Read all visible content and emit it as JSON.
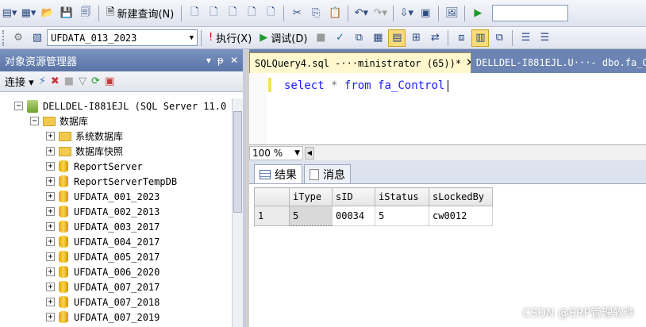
{
  "toolbar1": {
    "new_query_label": "新建查询(N)"
  },
  "toolbar2": {
    "database_combo": "UFDATA_013_2023",
    "execute_label": "执行(X)",
    "debug_label": "调试(D)"
  },
  "object_explorer": {
    "title": "对象资源管理器",
    "pin_glyph": "ꟷ ₱ ✕",
    "connect_label": "连接",
    "server": "DELLDEL-I881EJL (SQL Server 11.0",
    "databases_folder": "数据库",
    "items": [
      {
        "label": "系统数据库",
        "type": "folder"
      },
      {
        "label": "数据库快照",
        "type": "folder"
      },
      {
        "label": "ReportServer",
        "type": "db"
      },
      {
        "label": "ReportServerTempDB",
        "type": "db"
      },
      {
        "label": "UFDATA_001_2023",
        "type": "db"
      },
      {
        "label": "UFDATA_002_2013",
        "type": "db"
      },
      {
        "label": "UFDATA_003_2017",
        "type": "db"
      },
      {
        "label": "UFDATA_004_2017",
        "type": "db"
      },
      {
        "label": "UFDATA_005_2017",
        "type": "db"
      },
      {
        "label": "UFDATA_006_2020",
        "type": "db"
      },
      {
        "label": "UFDATA_007_2017",
        "type": "db"
      },
      {
        "label": "UFDATA_007_2018",
        "type": "db"
      },
      {
        "label": "UFDATA_007_2019",
        "type": "db"
      }
    ]
  },
  "tabs": {
    "active": "SQLQuery4.sql -···ministrator (65))*",
    "active_close": "✕",
    "inactive": "DELLDEL-I881EJL.U···- dbo.fa_C"
  },
  "editor": {
    "kw1": "select",
    "star": "*",
    "kw2": "from",
    "table": "fa_Control"
  },
  "zoom": "100 %",
  "result_tabs": {
    "results": "结果",
    "messages": "消息"
  },
  "results": {
    "columns": [
      "iType",
      "sID",
      "iStatus",
      "sLockedBy"
    ],
    "rows": [
      {
        "num": "1",
        "cells": [
          "5",
          "00034",
          "5",
          "cw0012"
        ]
      }
    ]
  },
  "watermark": "CSDN @ERP管理软件",
  "colors": {
    "title_bar": "#5a74a6",
    "tab_active": "#fff8cf",
    "keyword": "#1a1aff"
  }
}
